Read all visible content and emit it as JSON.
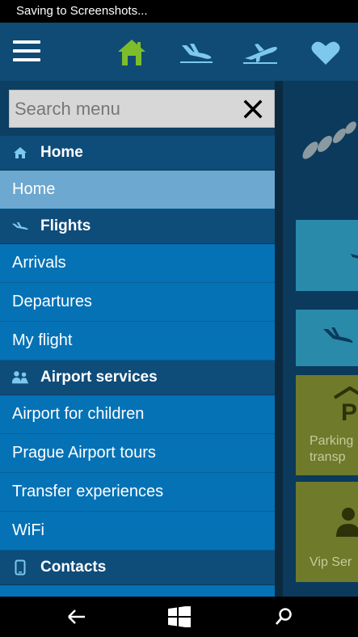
{
  "status_bar": {
    "text": "Saving to Screenshots..."
  },
  "top_nav": {
    "icons": [
      "menu-icon",
      "home-icon",
      "arrivals-plane-icon",
      "departures-plane-icon",
      "heart-icon"
    ],
    "home_color": "#7dbd2a",
    "icon_color": "#7ec8ee"
  },
  "search": {
    "placeholder": "Search menu",
    "value": ""
  },
  "menu": {
    "sections": [
      {
        "title": "Home",
        "icon": "home-icon",
        "items": [
          {
            "label": "Home",
            "selected": true
          }
        ]
      },
      {
        "title": "Flights",
        "icon": "plane-icon",
        "items": [
          {
            "label": "Arrivals"
          },
          {
            "label": "Departures"
          },
          {
            "label": "My flight"
          }
        ]
      },
      {
        "title": "Airport services",
        "icon": "people-icon",
        "items": [
          {
            "label": "Airport for children"
          },
          {
            "label": "Prague Airport tours"
          },
          {
            "label": "Transfer experiences"
          },
          {
            "label": "WiFi"
          }
        ]
      },
      {
        "title": "Contacts",
        "icon": "phone-icon",
        "items": []
      }
    ]
  },
  "background_tiles": {
    "parking_label_1": "Parking",
    "parking_label_2": "transp",
    "vip_label": "Vip Ser"
  },
  "colors": {
    "menu_item": "#0572b6",
    "section_header": "#0e4c7a",
    "selected_item": "#6ca8cf",
    "tile_blue": "#2a8aaa",
    "tile_olive": "#6f7a2a"
  },
  "bottom_nav": {
    "icons": [
      "back-icon",
      "windows-start-icon",
      "search-icon"
    ]
  }
}
